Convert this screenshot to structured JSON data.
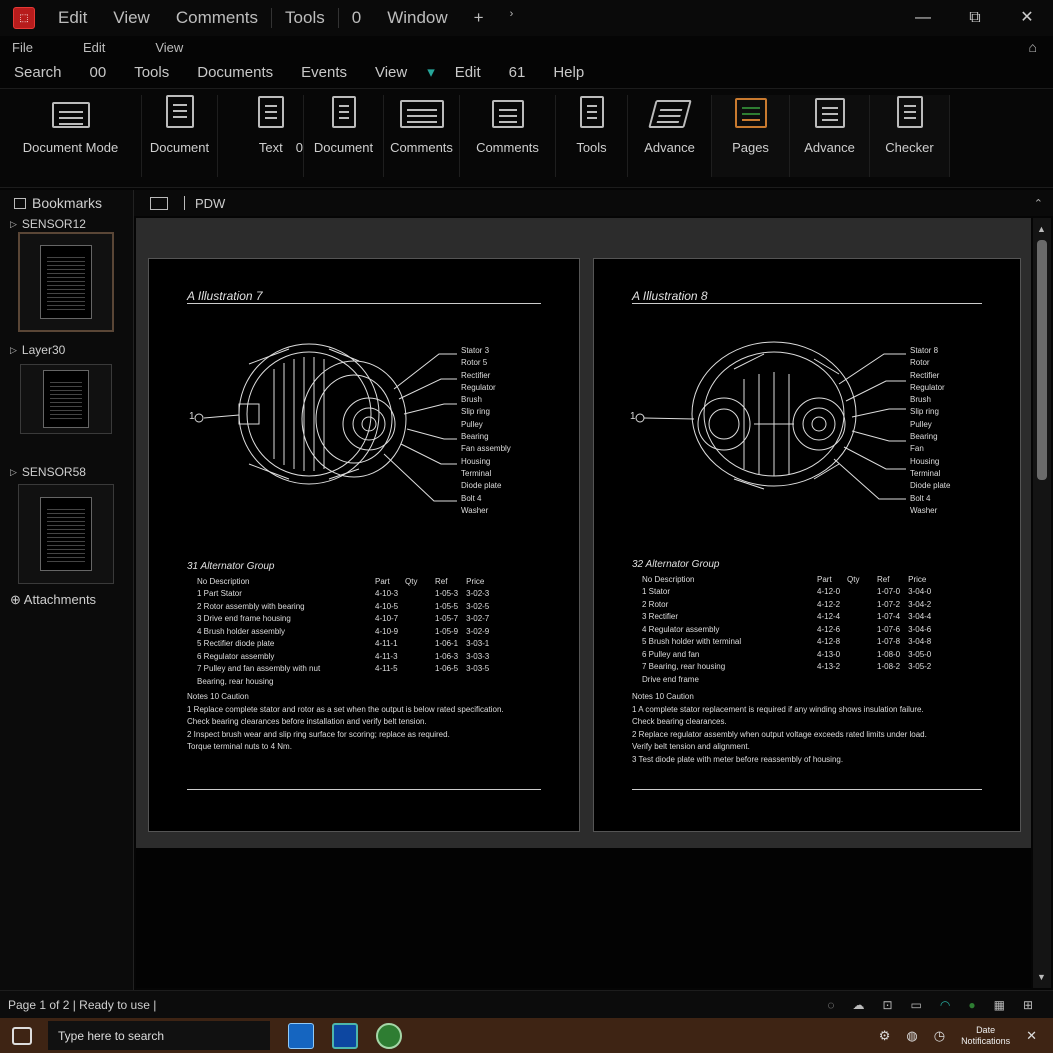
{
  "app": {
    "title_menu": [
      "Edit",
      "View",
      "Comments",
      "Tools",
      "Window"
    ],
    "title_extra": "0",
    "controls": [
      "—",
      "⧉",
      "✕"
    ]
  },
  "menu_row1": [
    "File",
    "Edit",
    "View"
  ],
  "menu_row2": [
    "Search",
    "00",
    "Tools",
    "Documents",
    "Events",
    "View",
    "Edit",
    "61",
    "Help"
  ],
  "ribbon": {
    "groups": [
      {
        "label": "Document Mode"
      },
      {
        "label": "Document"
      },
      {
        "label": "Text",
        "extra": "0"
      },
      {
        "label": "Document"
      },
      {
        "label": "Comments"
      },
      {
        "label": "Comments"
      },
      {
        "label": "Tools"
      },
      {
        "label": "Advance"
      },
      {
        "label": "Pages"
      },
      {
        "label": "Advance"
      },
      {
        "label": "Checker"
      }
    ]
  },
  "left_panel": {
    "header": "Bookmarks",
    "items": [
      "SENSOR12",
      "Layer30",
      "SENSOR58"
    ],
    "attachments": "Attachments"
  },
  "doc_header": {
    "label": "PDW",
    "collapse": "⌃"
  },
  "pages": [
    {
      "title": "A  Illustration 7",
      "ref": "1",
      "callouts": [
        "Stator 3",
        "Rotor 5",
        "Rectifier",
        "Regulator",
        "Brush",
        "Slip ring",
        "Pulley",
        "Bearing",
        "Fan assembly",
        "Housing",
        "Terminal",
        "Diode plate",
        "Bolt 4",
        "Washer"
      ],
      "section_title": "31  Alternator Group",
      "table_header": [
        "No  Description",
        "Part",
        "Qty",
        "Ref",
        "Price"
      ],
      "table_rows": [
        [
          "1  Part  Stator",
          "4-10-3",
          "1-05-3",
          "3-02-3"
        ],
        [
          "2  Rotor assembly with bearing",
          "4-10-5",
          "1-05-5",
          "3-02-5"
        ],
        [
          "3  Drive end frame housing",
          "4-10-7",
          "1-05-7",
          "3-02-7"
        ],
        [
          "4  Brush holder assembly",
          "4-10-9",
          "1-05-9",
          "3-02-9"
        ],
        [
          "5  Rectifier diode plate",
          "4-11-1",
          "1-06-1",
          "3-03-1"
        ],
        [
          "6  Regulator assembly",
          "4-11-3",
          "1-06-3",
          "3-03-3"
        ],
        [
          "7  Pulley and fan assembly with nut",
          "4-11-5",
          "1-06-5",
          "3-03-5"
        ],
        [
          "    Bearing, rear housing",
          "",
          "",
          ""
        ]
      ],
      "notes_title": "Notes  10  Caution",
      "notes": [
        "1  Replace complete stator and rotor as a set when the output is below rated specification.",
        "    Check bearing clearances before installation and verify belt tension.",
        "2  Inspect brush wear and slip ring surface for scoring; replace as required.",
        "    Torque terminal nuts to 4 Nm."
      ]
    },
    {
      "title": "A  Illustration 8",
      "ref": "1",
      "callouts": [
        "Stator 8",
        "Rotor",
        "Rectifier",
        "Regulator",
        "Brush",
        "Slip ring",
        "Pulley",
        "Bearing",
        "Fan",
        "Housing",
        "Terminal",
        "Diode plate",
        "Bolt 4",
        "Washer"
      ],
      "section_title": "32  Alternator Group",
      "table_header": [
        "No  Description",
        "Part",
        "Qty",
        "Ref",
        "Price"
      ],
      "table_rows": [
        [
          "1  Stator",
          "4-12-0",
          "1-07-0",
          "3-04-0"
        ],
        [
          "2  Rotor",
          "4-12-2",
          "1-07-2",
          "3-04-2"
        ],
        [
          "3  Rectifier",
          "4-12-4",
          "1-07-4",
          "3-04-4"
        ],
        [
          "4  Regulator assembly",
          "4-12-6",
          "1-07-6",
          "3-04-6"
        ],
        [
          "5  Brush holder with terminal",
          "4-12-8",
          "1-07-8",
          "3-04-8"
        ],
        [
          "6  Pulley and fan",
          "4-13-0",
          "1-08-0",
          "3-05-0"
        ],
        [
          "7  Bearing, rear housing",
          "4-13-2",
          "1-08-2",
          "3-05-2"
        ],
        [
          "    Drive end frame",
          "",
          "",
          ""
        ]
      ],
      "notes_title": "Notes  10  Caution",
      "notes": [
        "1  A complete stator replacement is required if any winding shows insulation failure.",
        "    Check bearing clearances.",
        "2  Replace regulator assembly when output voltage exceeds rated limits under load.",
        "    Verify belt tension and alignment.",
        "3  Test diode plate with meter before reassembly of housing."
      ]
    }
  ],
  "status_bar": {
    "text": "Page 1 of 2  |  Ready to use  |"
  },
  "taskbar": {
    "search": "Type here to search",
    "clock_time": "Date",
    "clock_date": "Notifications",
    "close": "✕"
  },
  "colors": {
    "app_icon": "#b71c1c",
    "taskbar": "#3e2414",
    "accent_teal": "#26a69a",
    "accent_orange": "#c97a2f",
    "accent_green": "#2e7d32"
  }
}
